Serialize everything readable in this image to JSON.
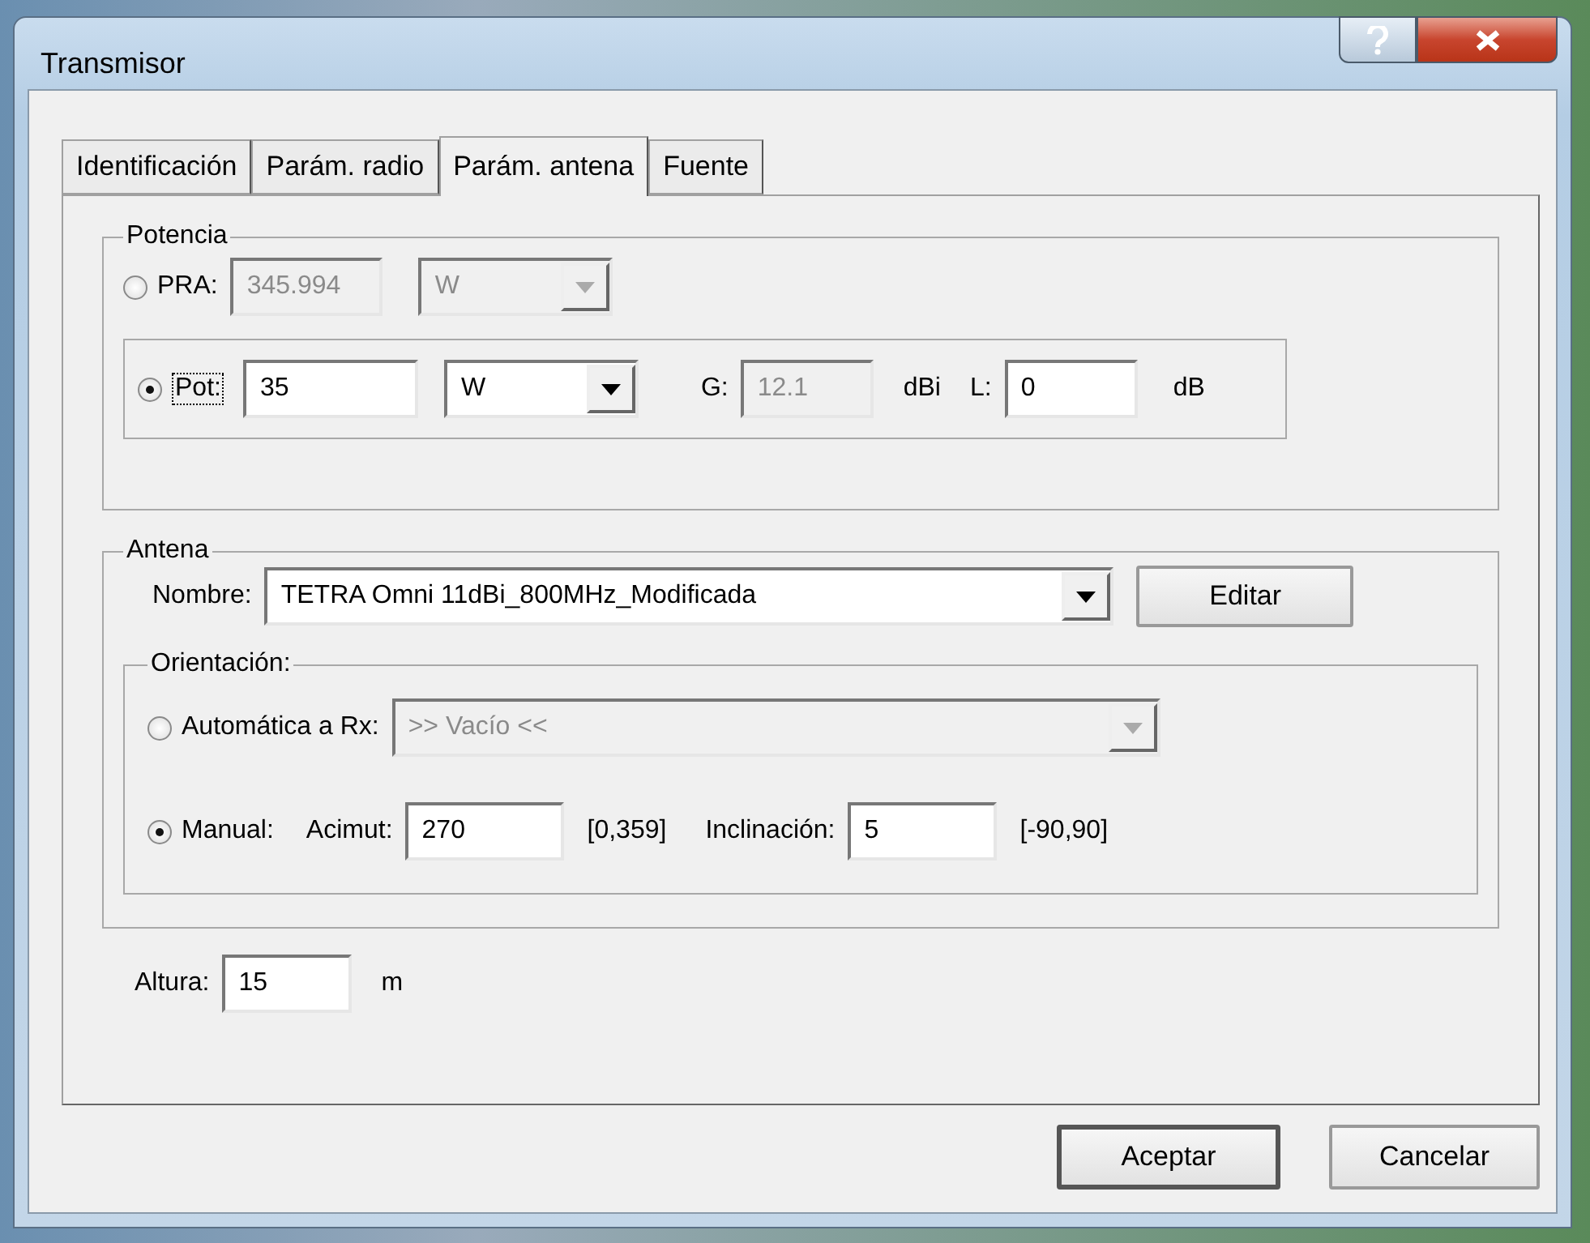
{
  "window": {
    "title": "Transmisor"
  },
  "tabs": [
    {
      "label": "Identificación",
      "selected": false
    },
    {
      "label": "Parám. radio",
      "selected": false
    },
    {
      "label": "Parám. antena",
      "selected": true
    },
    {
      "label": "Fuente",
      "selected": false
    }
  ],
  "potencia": {
    "legend": "Potencia",
    "pra": {
      "label": "PRA:",
      "selected": false,
      "value": "345.994",
      "value_disabled": true,
      "unit": "W",
      "unit_disabled": true
    },
    "pot": {
      "label": "Pot:",
      "selected": true,
      "focused": true,
      "value": "35",
      "value_disabled": false,
      "unit": "W",
      "unit_disabled": false
    },
    "gain": {
      "label": "G:",
      "value": "12.1",
      "disabled": true,
      "unit": "dBi"
    },
    "loss": {
      "label": "L:",
      "value": "0",
      "disabled": false,
      "unit": "dB"
    }
  },
  "antena": {
    "legend": "Antena",
    "name_label": "Nombre:",
    "name_value": "TETRA Omni 11dBi_800MHz_Modificada",
    "edit_button": "Editar",
    "orientation": {
      "legend": "Orientación:",
      "auto": {
        "label": "Automática a Rx:",
        "selected": false,
        "value": ">> Vacío <<",
        "disabled": true
      },
      "manual": {
        "label": "Manual:",
        "selected": true,
        "azimuth_label": "Acimut:",
        "azimuth": "270",
        "azimuth_range": "[0,359]",
        "tilt_label": "Inclinación:",
        "tilt": "5",
        "tilt_range": "[-90,90]"
      }
    }
  },
  "height": {
    "label": "Altura:",
    "value": "15",
    "unit": "m"
  },
  "buttons": [
    {
      "label": "Aceptar",
      "default": true
    },
    {
      "label": "Cancelar",
      "default": false
    }
  ]
}
